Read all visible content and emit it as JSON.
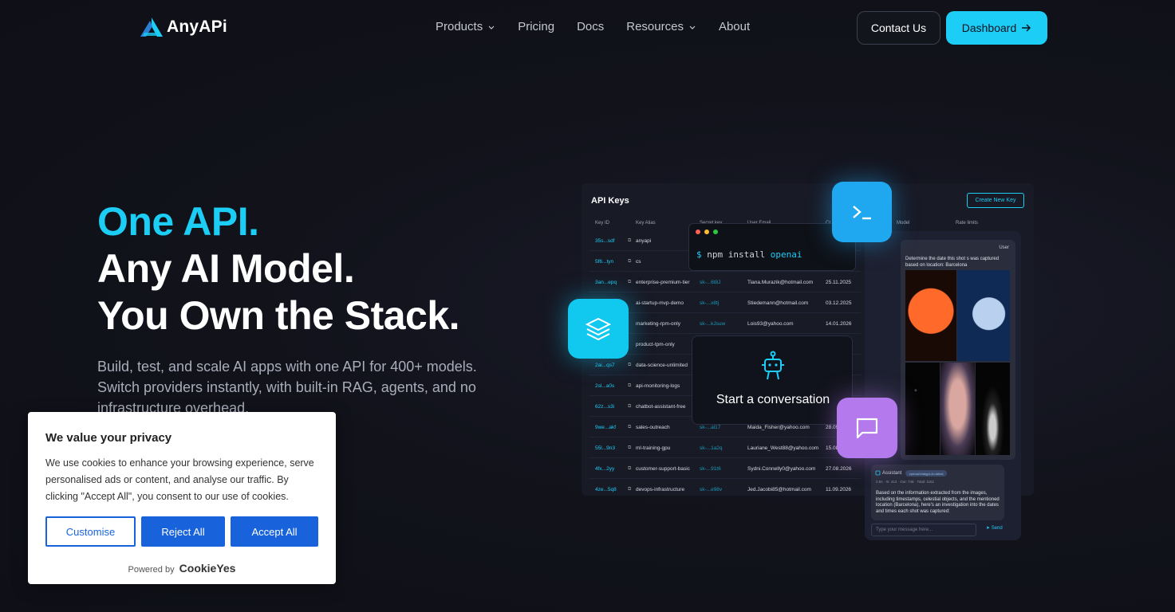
{
  "nav": {
    "brand": "AnyAPi",
    "links": [
      {
        "label": "Products",
        "dropdown": true
      },
      {
        "label": "Pricing",
        "dropdown": false
      },
      {
        "label": "Docs",
        "dropdown": false
      },
      {
        "label": "Resources",
        "dropdown": true
      },
      {
        "label": "About",
        "dropdown": false
      }
    ],
    "contact_label": "Contact Us",
    "dashboard_label": "Dashboard"
  },
  "hero": {
    "line1": "One API.",
    "line2": "Any AI Model.",
    "line3": "You Own the Stack.",
    "description": "Build, test, and scale AI apps with one API for 400+ models. Switch providers instantly, with built-in RAG, agents, and no infrastructure overhead."
  },
  "dashboard": {
    "title": "API Keys",
    "new_key": "Create New Key",
    "headers": [
      "Key ID",
      "Key Alias",
      "Secret key",
      "User Email",
      "Cr...",
      "Model",
      "Rate limits"
    ],
    "rows": [
      {
        "id": "35s...sdf",
        "alias": "anyapi",
        "secret": "",
        "email": "",
        "date": ""
      },
      {
        "id": "5f6...tyn",
        "alias": "cs",
        "secret": "",
        "email": "",
        "date": ""
      },
      {
        "id": "3an...epq",
        "alias": "enterprise-premium-tier",
        "secret": "sk-...6t8J",
        "email": "Tiana.Murazik@hotmail.com",
        "date": "25.11.2025"
      },
      {
        "id": "",
        "alias": "ai-startup-mvp-demo",
        "secret": "sk-...x8tj",
        "email": "Stiedemann@hotmail.com",
        "date": "03.12.2025"
      },
      {
        "id": "",
        "alias": "marketing-rpm-only",
        "secret": "sk-...kJsuw",
        "email": "Lois93@yahoo.com",
        "date": "14.01.2026"
      },
      {
        "id": "",
        "alias": "product-tpm-only",
        "secret": "",
        "email": "",
        "date": ""
      },
      {
        "id": "2ai...qs7",
        "alias": "data-science-unlimited",
        "secret": "",
        "email": "",
        "date": ""
      },
      {
        "id": "2sl...a0s",
        "alias": "api-monitoring-logs",
        "secret": "",
        "email": "",
        "date": ""
      },
      {
        "id": "62z...s3i",
        "alias": "chatbot-assistant-free",
        "secret": "",
        "email": "",
        "date": ""
      },
      {
        "id": "9we...akf",
        "alias": "sales-outreach",
        "secret": "sk-...al17",
        "email": "Maida_Fisher@yahoo.com",
        "date": "28.09..."
      },
      {
        "id": "55l...9n3",
        "alias": "ml-training-gpu",
        "secret": "sk-...1a2q",
        "email": "Lauriane_West88@yahoo.com",
        "date": "15.08.2025"
      },
      {
        "id": "4fx...2yy",
        "alias": "customer-support-basic",
        "secret": "sk-...91t6",
        "email": "Sydni.Connelly0@yahoo.com",
        "date": "27.08.2026"
      },
      {
        "id": "4ze...5q8",
        "alias": "devops-infrastructure",
        "secret": "sk-...e98v",
        "email": "Jed.Jacobi85@hotmail.com",
        "date": "11.09.2026"
      }
    ],
    "terminal": {
      "prompt": "$",
      "command": "npm install",
      "arg": "openai"
    },
    "conversation": "Start a conversation",
    "chat": {
      "user_label": "User",
      "user_question": "Determine the date this shot s was captured based on location: Barcelona",
      "assistant_label": "Assistant",
      "assistant_tag": "openai/chatgpt-4o-latest",
      "assistant_stats": "2.5s · In: 413 · Out: 748 · Total: 1161",
      "assistant_text": "Based on the information extracted from the images, including timestamps, celestial objects, and the mentioned location (Barcelona), here's an investigation into the dates and times each shot was captured:",
      "input_placeholder": "Type your message here...",
      "send_label": "Send"
    }
  },
  "cookie": {
    "title": "We value your privacy",
    "text": "We use cookies to enhance your browsing experience, serve personalised ads or content, and analyse our traffic. By clicking \"Accept All\", you consent to our use of cookies.",
    "customise": "Customise",
    "reject": "Reject All",
    "accept": "Accept All",
    "powered_by": "Powered by",
    "powered_brand": "CookieYes"
  },
  "colors": {
    "accent": "#1ccdf5",
    "purple": "#b379ed",
    "cookie_blue": "#1863dc"
  }
}
